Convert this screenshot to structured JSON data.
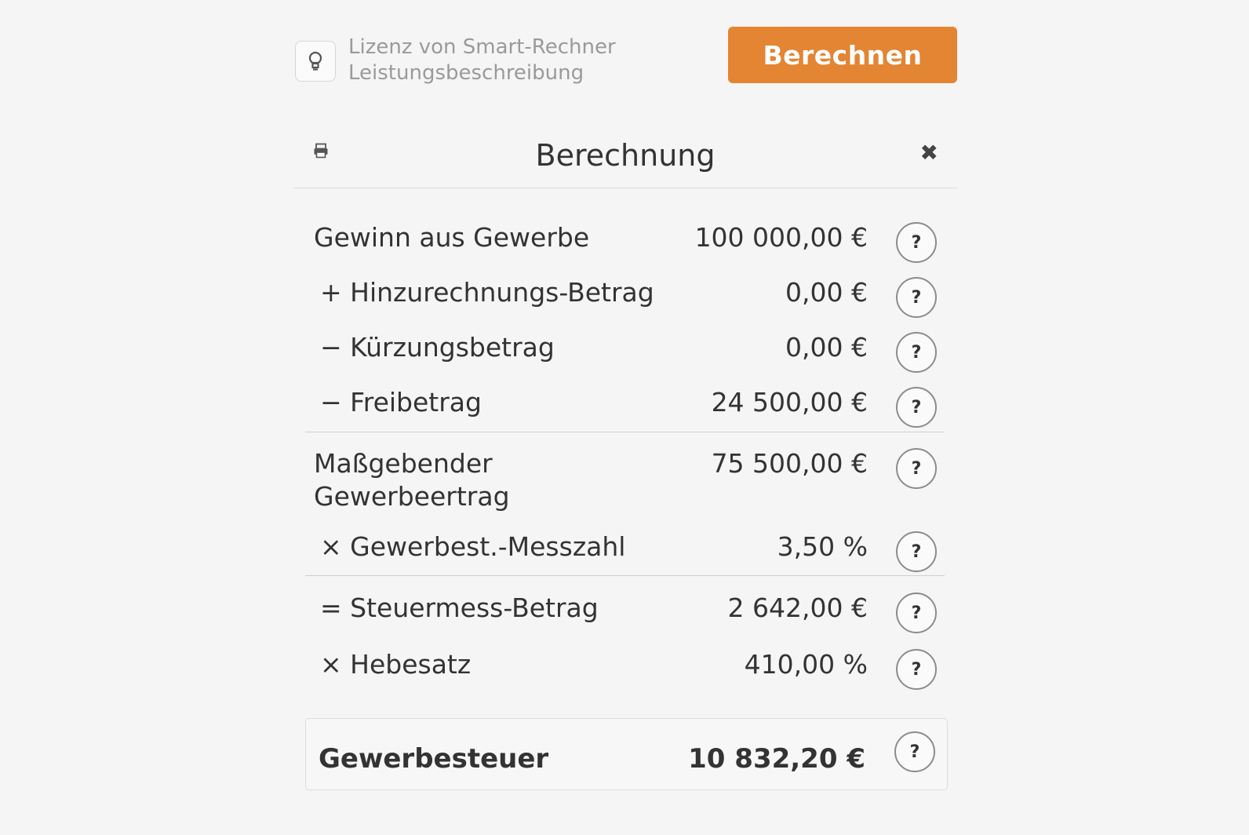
{
  "license": {
    "line1": "Lizenz von Smart-Rechner",
    "line2": "Leistungsbeschreibung",
    "icon": "lightbulb-icon"
  },
  "actions": {
    "calculate_label": "Berechnen",
    "accent_color": "#e38533"
  },
  "panel": {
    "title": "Berechnung",
    "print_icon": "printer-icon",
    "close_glyph": "✖"
  },
  "help_glyph": "?",
  "rows": [
    {
      "label": "Gewinn aus Gewerbe",
      "value": "100 000,00 €"
    },
    {
      "label": "+ Hinzurechnungs-Betrag",
      "value": "0,00 €"
    },
    {
      "label": "− Kürzungsbetrag",
      "value": "0,00 €"
    },
    {
      "label": "− Freibetrag",
      "value": "24 500,00 €"
    },
    {
      "label_line1": "Maßgebender",
      "label_line2": "Gewerbeertrag",
      "value": "75 500,00 €"
    },
    {
      "label": "× Gewerbest.-Messzahl",
      "value": "3,50 %"
    },
    {
      "label": "= Steuermess-Betrag",
      "value": "2 642,00 €"
    },
    {
      "label": "× Hebesatz",
      "value": "410,00 %"
    }
  ],
  "total": {
    "label": "Gewerbesteuer",
    "value": "10 832,20 €"
  }
}
